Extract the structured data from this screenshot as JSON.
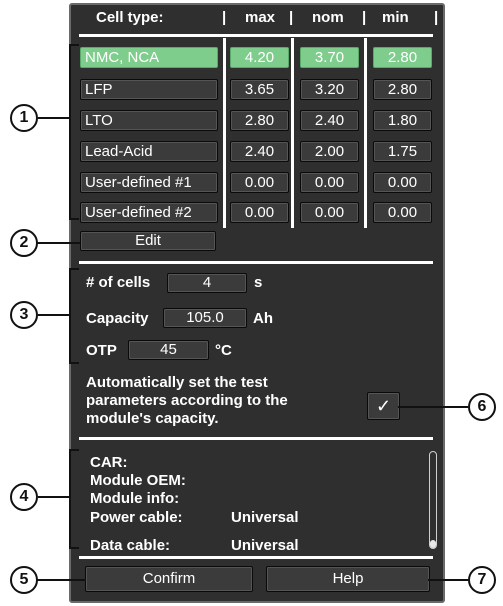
{
  "header": {
    "cell_type": "Cell type:",
    "sep": "|",
    "max": "max",
    "nom": "nom",
    "min": "min"
  },
  "cell_rows": [
    {
      "name": "NMC, NCA",
      "max": "4.20",
      "nom": "3.70",
      "min": "2.80",
      "selected": true
    },
    {
      "name": "LFP",
      "max": "3.65",
      "nom": "3.20",
      "min": "2.80",
      "selected": false
    },
    {
      "name": "LTO",
      "max": "2.80",
      "nom": "2.40",
      "min": "1.80",
      "selected": false
    },
    {
      "name": "Lead-Acid",
      "max": "2.40",
      "nom": "2.00",
      "min": "1.75",
      "selected": false
    },
    {
      "name": "User-defined #1",
      "max": "0.00",
      "nom": "0.00",
      "min": "0.00",
      "selected": false
    },
    {
      "name": "User-defined #2",
      "max": "0.00",
      "nom": "0.00",
      "min": "0.00",
      "selected": false
    }
  ],
  "edit_label": "Edit",
  "settings": {
    "cells_label": "# of cells",
    "cells_value": "4",
    "cells_unit": "s",
    "capacity_label": "Capacity",
    "capacity_value": "105.0",
    "capacity_unit": "Ah",
    "otp_label": "OTP",
    "otp_value": "45",
    "otp_unit": "°C"
  },
  "auto_text": "Automatically set the test parameters according to the module's capacity.",
  "auto_checked": true,
  "checkmark": "✓",
  "info": [
    {
      "label": "CAR:",
      "value": ""
    },
    {
      "label": "Module OEM:",
      "value": ""
    },
    {
      "label": "Module info:",
      "value": ""
    },
    {
      "label": "Power cable:",
      "value": "Universal"
    },
    {
      "label": "Data cable:",
      "value": "Universal"
    }
  ],
  "confirm_label": "Confirm",
  "help_label": "Help",
  "callouts": [
    "1",
    "2",
    "3",
    "4",
    "5",
    "6",
    "7"
  ],
  "colors": {
    "selected": "#7fcd8c",
    "panel": "#2f2f2f",
    "field": "#3b3b3b"
  }
}
